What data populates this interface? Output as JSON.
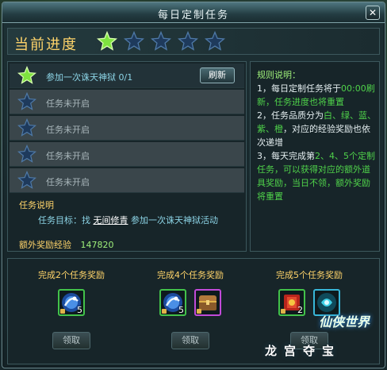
{
  "window": {
    "title": "每日定制任务",
    "close_label": "✕"
  },
  "progress": {
    "label": "当前进度",
    "stars_total": 5,
    "stars_filled": 1
  },
  "tasks": [
    {
      "text": "参加一次诛天神狱 0/1",
      "state": "active",
      "action_label": "刷新"
    },
    {
      "text": "任务未开启",
      "state": "locked"
    },
    {
      "text": "任务未开启",
      "state": "locked"
    },
    {
      "text": "任务未开启",
      "state": "locked"
    },
    {
      "text": "任务未开启",
      "state": "locked"
    }
  ],
  "description": {
    "title": "任务说明",
    "goal_prefix": "任务目标：找",
    "npc_link": "无间修青",
    "goal_suffix": "参加一次诛天神狱活动"
  },
  "extra_reward": {
    "label": "额外奖励经验",
    "value": "147820"
  },
  "rules": {
    "title": "规则说明：",
    "parts": [
      {
        "t": "1，每日定制任务将于",
        "c": "normal"
      },
      {
        "t": "00:00刷新，任务进度也将重置",
        "c": "hl"
      },
      {
        "t": "2，任务品质分为",
        "c": "normal"
      },
      {
        "t": "白、绿、蓝、紫、橙",
        "c": "hl"
      },
      {
        "t": "，对应的经验奖励也依次递增",
        "c": "normal"
      },
      {
        "t": "3，每天完成第",
        "c": "normal"
      },
      {
        "t": "2、4、5个定制任务，可以获得对应的额外道具奖励，当日不领，额外奖励将重置",
        "c": "hl"
      }
    ]
  },
  "reward_groups": [
    {
      "title": "完成2个任务奖励",
      "claim_label": "领取",
      "items": [
        {
          "icon": "blue-orb-icon",
          "count": "5",
          "border": "green"
        }
      ]
    },
    {
      "title": "完成4个任务奖励",
      "claim_label": "领取",
      "items": [
        {
          "icon": "blue-orb-icon",
          "count": "5",
          "border": "green"
        },
        {
          "icon": "treasure-chest-icon",
          "count": "",
          "border": "purple"
        }
      ]
    },
    {
      "title": "完成5个任务奖励",
      "claim_label": "领取",
      "items": [
        {
          "icon": "red-scroll-icon",
          "count": "2",
          "border": "green"
        },
        {
          "icon": "cyan-gem-icon",
          "count": "",
          "border": "cyan"
        }
      ]
    }
  ],
  "brand": {
    "logo": "仙侠世界",
    "name": "龙宫夺宝"
  },
  "colors": {
    "star_filled": "#7fe33f",
    "star_empty": "#1e3a5c",
    "gold_text": "#ffd46a",
    "green_text": "#4fd24a"
  }
}
